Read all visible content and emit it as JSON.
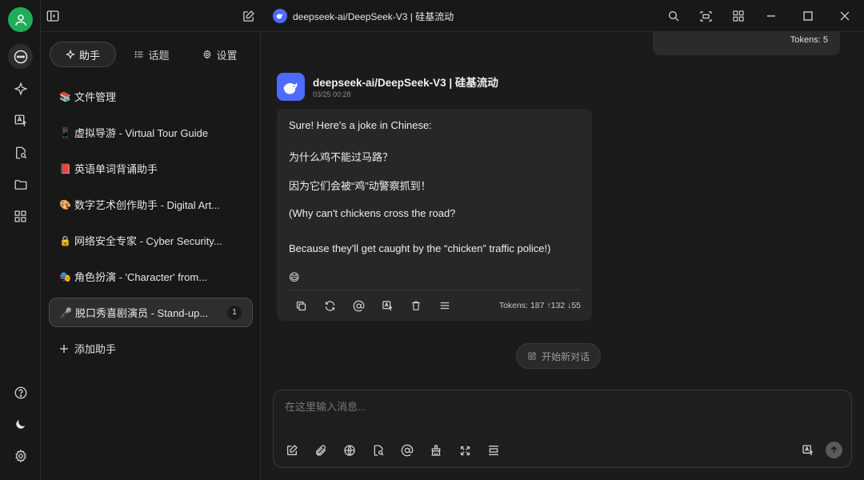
{
  "window": {
    "title": "deepseek-ai/DeepSeek-V3 | 硅基流动"
  },
  "sidebar_tabs": [
    {
      "label": "助手",
      "icon": "sparkle-icon"
    },
    {
      "label": "话题",
      "icon": "list-icon"
    },
    {
      "label": "设置",
      "icon": "gear-icon"
    }
  ],
  "assistants": [
    {
      "emoji": "📚",
      "label": "文件管理"
    },
    {
      "emoji": "📱",
      "label": "虚拟导游 - Virtual Tour Guide"
    },
    {
      "emoji": "📕",
      "label": "英语单词背诵助手"
    },
    {
      "emoji": "🎨",
      "label": "数字艺术创作助手 - Digital Art..."
    },
    {
      "emoji": "🔒",
      "label": "网络安全专家 - Cyber Security..."
    },
    {
      "emoji": "🎭",
      "label": "角色扮演 - 'Character' from..."
    },
    {
      "emoji": "🎤",
      "label": "脱口秀喜剧演员 - Stand-up...",
      "badge": "1",
      "active": true
    }
  ],
  "add_assistant": "添加助手",
  "previous_message": {
    "tokens": "Tokens: 5"
  },
  "message": {
    "sender": "deepseek-ai/DeepSeek-V3 | 硅基流动",
    "time": "03/25 00:28",
    "lines": [
      "Sure! Here's a joke in Chinese:",
      "为什么鸡不能过马路？",
      "因为它们会被“鸡”动警察抓到！",
      "(Why can't chickens cross the road?",
      "Because they'll get caught by the “chicken” traffic police!)",
      "😄"
    ],
    "tokens": "Tokens: 187 ↑132 ↓55"
  },
  "new_topic_label": "开始新对话",
  "composer": {
    "placeholder": "在这里输入消息..."
  },
  "colors": {
    "accent_green": "#1fae58",
    "deepseek_blue": "#4d6bfe",
    "background": "#1b1b1b"
  }
}
